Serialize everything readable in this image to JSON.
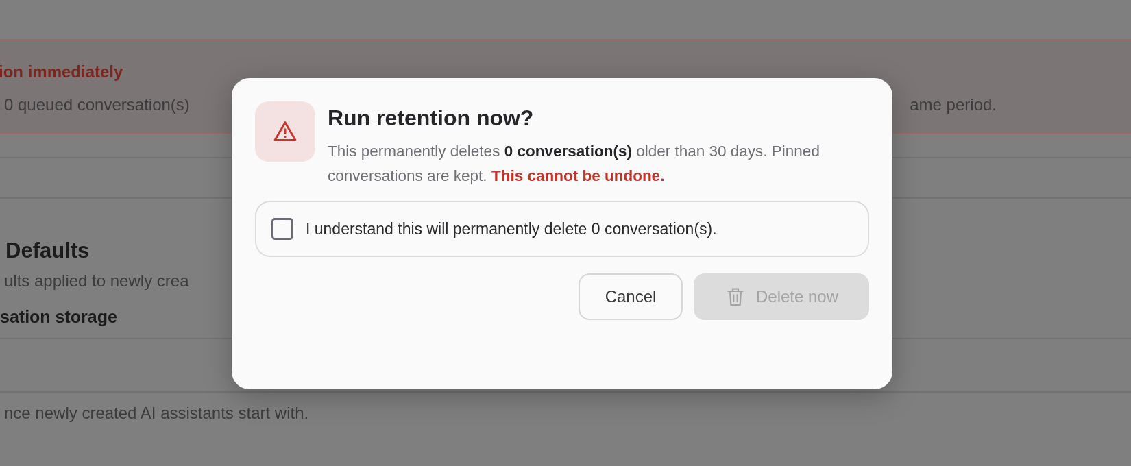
{
  "background": {
    "banner": {
      "title": "ion immediately",
      "text_left": "0 queued conversation(s)",
      "text_right": "ame period."
    },
    "section": {
      "heading": "Defaults",
      "subtitle": "ults applied to newly crea",
      "field_label": "sation storage",
      "field_hint": "nce newly created AI assistants start with."
    }
  },
  "dialog": {
    "title": "Run retention now?",
    "message": "This permanently deletes **0 conversation(s)** older than 30 days. Pinned conversations are kept. ",
    "warning": "This cannot be undone.",
    "confirm": {
      "label": "I understand this will permanently delete 0 conversation(s).",
      "checked": false
    },
    "buttons": [
      {
        "kind": "cancel",
        "label": "Cancel",
        "disabled": false
      },
      {
        "kind": "delete",
        "label": "Delete now",
        "disabled": true
      }
    ]
  }
}
